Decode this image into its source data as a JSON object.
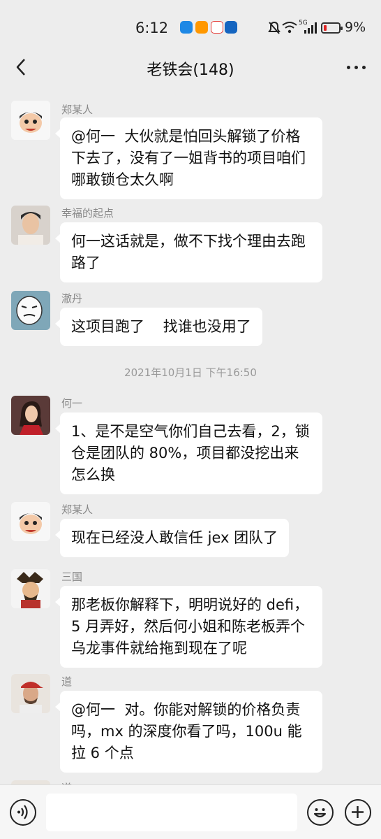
{
  "status_bar": {
    "time": "6:12",
    "battery": "9%",
    "battery_level": 0.09,
    "signal_label": "5G"
  },
  "header": {
    "title": "老铁会(148)"
  },
  "messages": [
    {
      "sender": "郑某人",
      "text": "@何一  大伙就是怕回头解锁了价格下去了，没有了一姐背书的项目咱们哪敢锁仓太久啊",
      "avatar_icon": "cartoon-face-avatar"
    },
    {
      "sender": "幸福的起点",
      "text": "何一这话就是，做不下找个理由去跑路了",
      "avatar_icon": "man-photo-avatar"
    },
    {
      "sender": "澈丹",
      "text": "这项目跑了    找谁也没用了",
      "avatar_icon": "meme-face-avatar"
    },
    {
      "sender": "何一",
      "text": "1、是不是空气你们自己去看，2，锁仓是团队的 80%，项目都没挖出来怎么换",
      "avatar_icon": "woman-photo-avatar"
    },
    {
      "sender": "郑某人",
      "text": "现在已经没人敢信任 jex 团队了",
      "avatar_icon": "cartoon-face-avatar"
    },
    {
      "sender": "三国",
      "text": "那老板你解释下，明明说好的 defi，5 月弄好，然后何小姐和陈老板弄个乌龙事件就给拖到现在了呢",
      "avatar_icon": "warrior-avatar"
    },
    {
      "sender": "道",
      "text": "@何一  对。你能对解锁的价格负责吗，mx 的深度你看了吗，100u 能拉 6 个点",
      "avatar_icon": "man-cap-avatar"
    },
    {
      "sender": "道",
      "text": "",
      "avatar_icon": "man-cap-avatar"
    }
  ],
  "timestamp": "2021年10月1日 下午16:50",
  "colors": {
    "background": "#ededed",
    "bubble": "#ffffff",
    "sender_text": "#888888"
  }
}
